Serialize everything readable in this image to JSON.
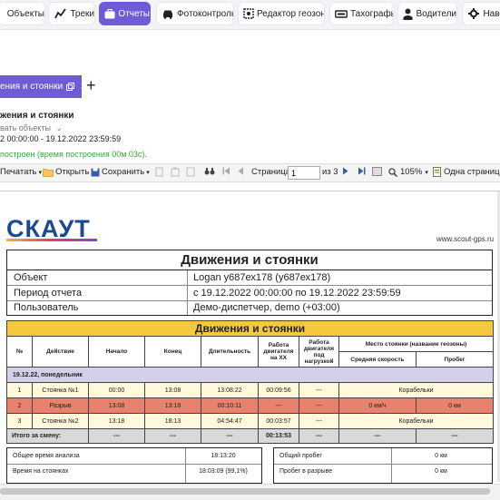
{
  "nav": {
    "items": [
      {
        "label": "Объекты",
        "icon": "objects-icon"
      },
      {
        "label": "Треки",
        "icon": "tracks-icon"
      },
      {
        "label": "Отчеты",
        "icon": "reports-icon",
        "active": true
      },
      {
        "label": "Фотоконтроль",
        "icon": "car-icon"
      },
      {
        "label": "Редактор геозон",
        "icon": "geofence-icon"
      },
      {
        "label": "Тахографы",
        "icon": "tachograph-icon"
      },
      {
        "label": "Водители",
        "icon": "driver-icon"
      },
      {
        "label": "Наве",
        "icon": "navigation-icon"
      }
    ]
  },
  "tab": {
    "label": "ения и стоянки",
    "add": "+",
    "close": "✕"
  },
  "report_info": {
    "title": "жения и стоянки",
    "objects": "вать объекты",
    "period": "2 00:00:00 - 19.12.2022 23:59:59",
    "status": "построен (время построения 00м 03с)."
  },
  "viewer": {
    "print": "Печатать",
    "open": "Открыть",
    "save": "Сохранить",
    "page_label": "Страница",
    "page_value": "1",
    "of_pages": "из 3",
    "zoom": "105%",
    "view_mode": "Одна страница"
  },
  "report": {
    "logo": "СКАУТ",
    "site": "www.scout-gps.ru",
    "title": "Движения и стоянки",
    "header_rows": [
      {
        "key": "Объект",
        "value": "Logan у687ех178 (у687ех178)"
      },
      {
        "key": "Период отчета",
        "value": "с  19.12.2022 00:00:00 по  19.12.2022 23:59:59"
      },
      {
        "key": "Пользователь",
        "value": "Демо-диспетчер, demo (+03:00)"
      }
    ],
    "table_title": "Движения и стоянки",
    "columns": [
      "№",
      "Действие",
      "Начало",
      "Конец",
      "Длительность",
      "Работа двигателя на ХХ",
      "Работа двигателя под нагрузкой",
      "Место стоянки (название геозоны)",
      "Средняя скорость",
      "Пробег"
    ],
    "day_label": "19.12.22, понедельник",
    "rows": [
      {
        "n": "1",
        "action": "Стоянка №1",
        "start": "00:00",
        "end": "13:08",
        "duration": "13:08:22",
        "idle": "00:09:56",
        "load": "---",
        "place": "Корабельки"
      },
      {
        "n": "2",
        "action": "Разрыв",
        "start": "13:08",
        "end": "13:18",
        "duration": "00:10:11",
        "idle": "---",
        "load": "---",
        "speed": "0 км/ч",
        "mileage": "0 км"
      },
      {
        "n": "3",
        "action": "Стоянка №2",
        "start": "13:18",
        "end": "18:13",
        "duration": "04:54:47",
        "idle": "00:03:57",
        "load": "---",
        "place": "Корабельки"
      }
    ],
    "total": {
      "label": "Итого за смену:",
      "start": "---",
      "end": "---",
      "duration": "---",
      "idle": "00:13:53",
      "load": "---",
      "speed": "---",
      "mileage": "---"
    },
    "summary_left": [
      {
        "key": "Общее время анализа",
        "value": "18:13:20"
      },
      {
        "key": "Время на стоянках",
        "value": "18:03:09 (99,1%)"
      }
    ],
    "summary_right": [
      {
        "key": "Общий пробег",
        "value": "0 км"
      },
      {
        "key": "Пробег в разрыве",
        "value": "0 км"
      }
    ]
  }
}
